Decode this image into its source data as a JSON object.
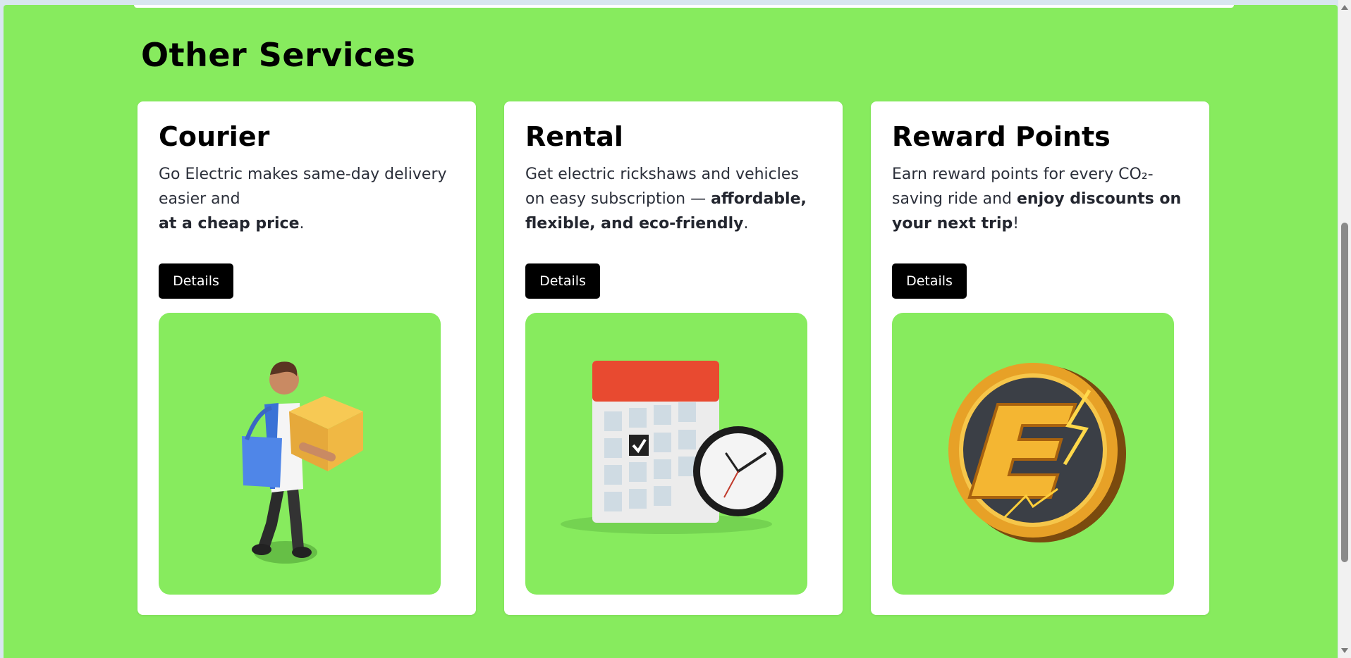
{
  "section": {
    "title": "Other Services"
  },
  "cards": [
    {
      "title": "Courier",
      "desc_plain": "Go Electric makes same-day delivery easier and",
      "desc_bold": "at a cheap price",
      "desc_end": ".",
      "button": "Details",
      "image": "delivery-person-icon"
    },
    {
      "title": "Rental",
      "desc_plain": "Get electric rickshaws and vehicles on easy subscription — ",
      "desc_bold": "affordable, flexible, and eco-friendly",
      "desc_end": ".",
      "button": "Details",
      "image": "calendar-clock-icon"
    },
    {
      "title": "Reward Points",
      "desc_plain": "Earn reward points for every CO₂-saving ride and ",
      "desc_bold": "enjoy discounts on your next trip",
      "desc_end": "!",
      "button": "Details",
      "image": "reward-coin-icon"
    }
  ],
  "colors": {
    "accent_green": "#87eb5e",
    "button_bg": "#000000"
  }
}
